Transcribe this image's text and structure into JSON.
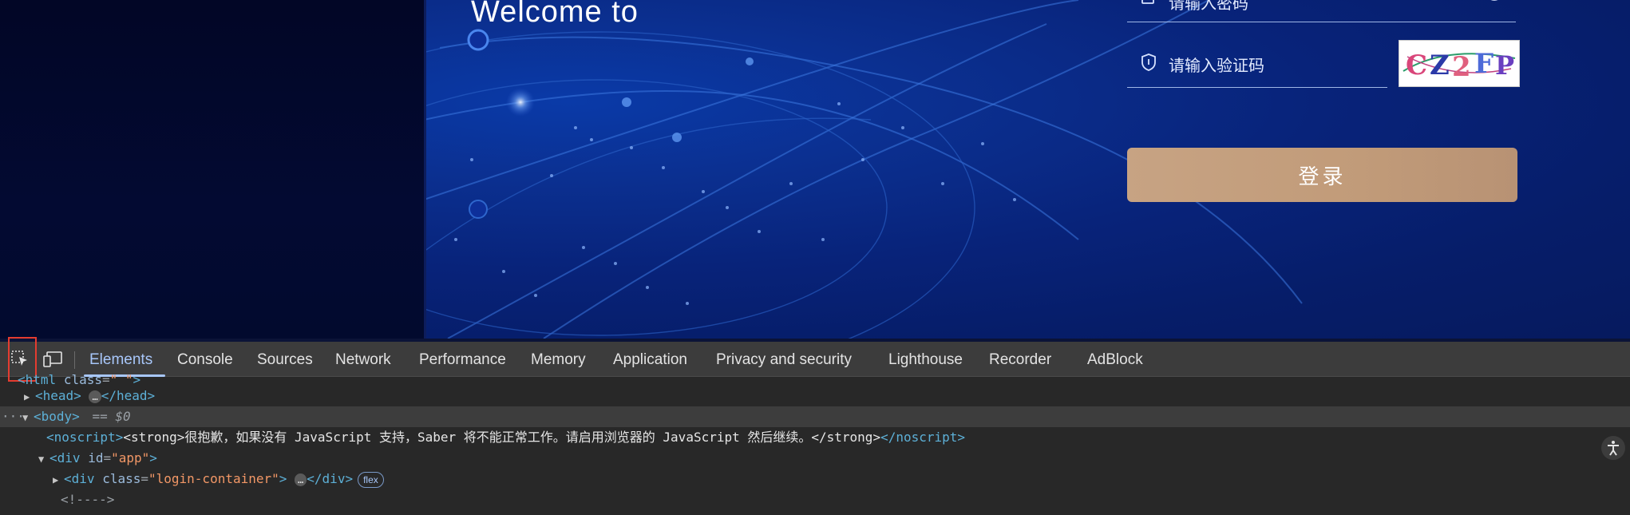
{
  "page": {
    "welcome_text": "Welcome to",
    "password_placeholder": "请输入密码",
    "captcha_placeholder": "请输入验证码",
    "captcha_text": "CZ2FP",
    "login_label": "登录",
    "colors": {
      "login_button": "#c19b79",
      "hero_bg": "#082a86"
    }
  },
  "devtools": {
    "tabs": [
      {
        "label": "Elements",
        "active": true
      },
      {
        "label": "Console"
      },
      {
        "label": "Sources"
      },
      {
        "label": "Network"
      },
      {
        "label": "Performance"
      },
      {
        "label": "Memory"
      },
      {
        "label": "Application"
      },
      {
        "label": "Privacy and security"
      },
      {
        "label": "Lighthouse"
      },
      {
        "label": "Recorder"
      },
      {
        "label": "AdBlock"
      }
    ],
    "dom": {
      "html_open": "html",
      "html_class": "class",
      "html_class_val": "\" \"",
      "head_tag": "head",
      "head_close": "</head>",
      "body_tag": "body",
      "body_eq": "== $0",
      "noscript_open": "<noscript>",
      "noscript_text": "<strong>很抱歉，如果没有 JavaScript 支持，Saber 将不能正常工作。请启用浏览器的 JavaScript 然后继续。</strong>",
      "noscript_close": "</noscript>",
      "div_app": "div",
      "div_app_attr": "id",
      "div_app_val": "\"app\"",
      "div_login": "div",
      "div_login_attr": "class",
      "div_login_val": "\"login-container\"",
      "div_login_close": "</div>",
      "flex_badge": "flex",
      "comment": "<!---->",
      "ellipsis": "…"
    }
  }
}
